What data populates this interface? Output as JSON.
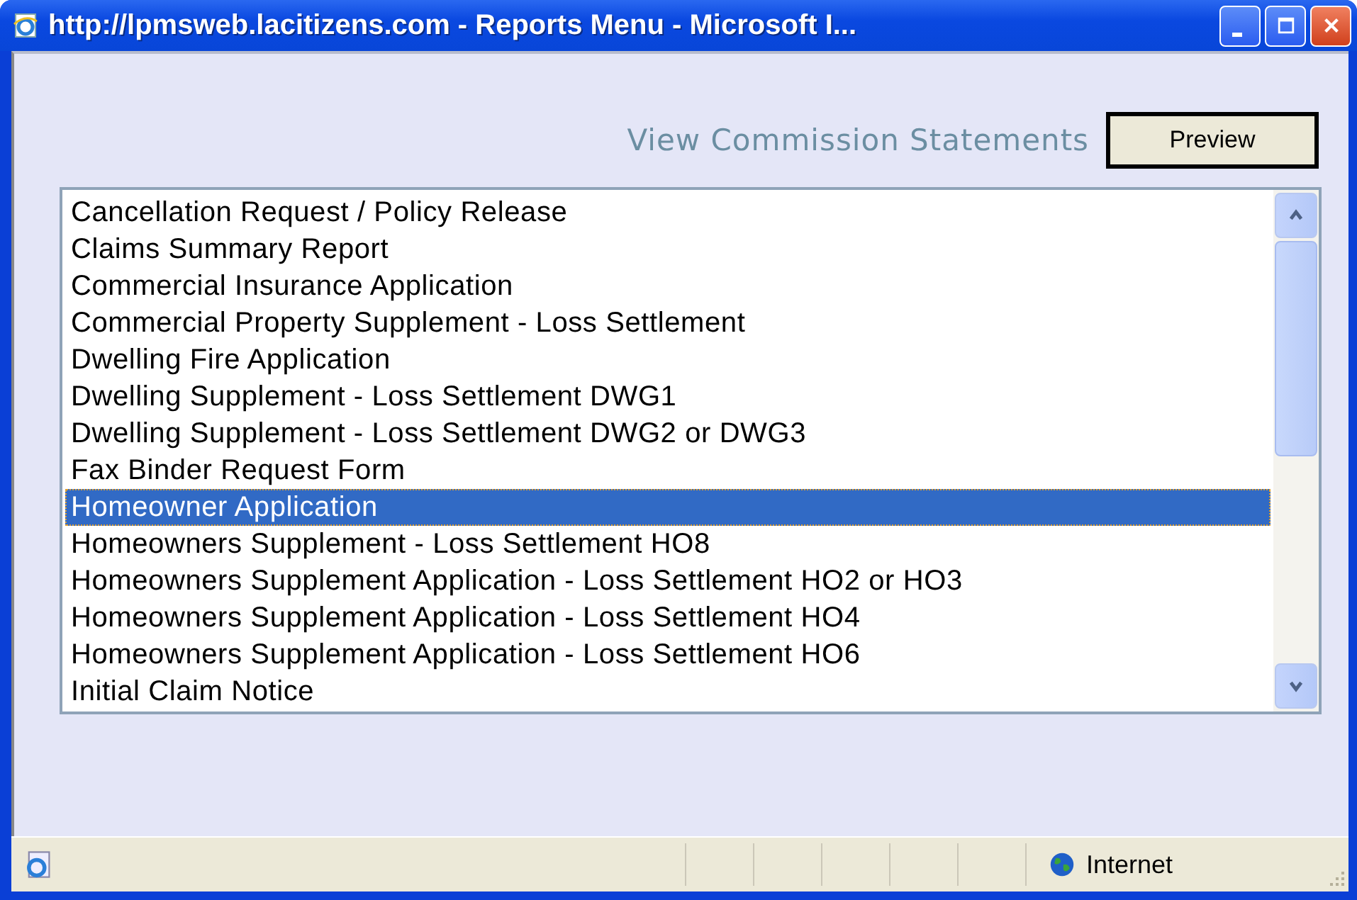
{
  "window": {
    "title": "http://lpmsweb.lacitizens.com - Reports Menu - Microsoft I..."
  },
  "header": {
    "link": "View Commission Statements",
    "button": "Preview"
  },
  "list": {
    "items": [
      {
        "label": "Cancellation Request / Policy Release",
        "selected": false
      },
      {
        "label": "Claims Summary Report",
        "selected": false
      },
      {
        "label": "Commercial Insurance Application",
        "selected": false
      },
      {
        "label": "Commercial Property Supplement - Loss Settlement",
        "selected": false
      },
      {
        "label": "Dwelling Fire Application",
        "selected": false
      },
      {
        "label": "Dwelling Supplement - Loss Settlement DWG1",
        "selected": false
      },
      {
        "label": "Dwelling Supplement - Loss Settlement DWG2 or DWG3",
        "selected": false
      },
      {
        "label": "Fax Binder Request Form",
        "selected": false
      },
      {
        "label": "Homeowner Application",
        "selected": true
      },
      {
        "label": "Homeowners Supplement - Loss Settlement HO8",
        "selected": false
      },
      {
        "label": "Homeowners Supplement Application - Loss Settlement HO2 or HO3",
        "selected": false
      },
      {
        "label": "Homeowners Supplement Application - Loss Settlement HO4",
        "selected": false
      },
      {
        "label": "Homeowners Supplement Application - Loss Settlement HO6",
        "selected": false
      },
      {
        "label": "Initial Claim Notice",
        "selected": false
      }
    ]
  },
  "status_bar": {
    "zone": "Internet"
  }
}
